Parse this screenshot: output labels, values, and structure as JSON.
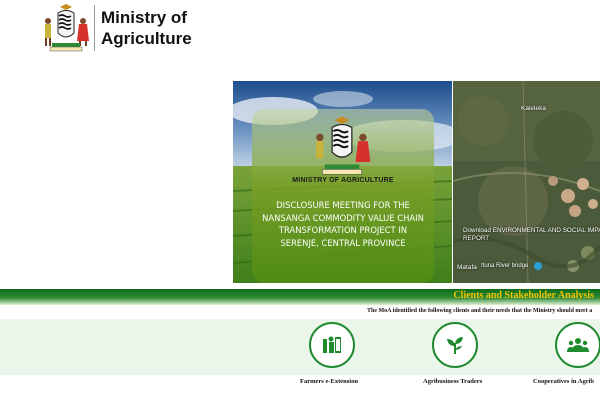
{
  "header": {
    "brand_line1": "Ministry of",
    "brand_line2": "Agriculture",
    "logo_icon": "zambia-coat-of-arms-icon"
  },
  "slideshow": {
    "card_ministry": "MINISTRY OF AGRICULTURE",
    "card_title": "DISCLOSURE MEETING FOR THE NANSANGA COMMODITY VALUE CHAIN TRANSFORMATION PROJECT IN SERENJE, CENTRAL PROVINCE"
  },
  "map": {
    "place_label": "Kaleleka",
    "download_text": "Download ENVIRONMENTAL AND SOCIAL IMPA FINAL REPORT",
    "bottom_label": "Matafa",
    "bridge_label": "Ituna River bridge"
  },
  "clients_section": {
    "title": "Clients and Stakeholder Analysis",
    "intro": "The MoA identified the following clients and their needs that the Ministry should meet a",
    "items": [
      {
        "label": "Farmers e-Extension",
        "icon": "farmers-icon"
      },
      {
        "label": "Agribusiness Traders",
        "icon": "plant-icon"
      },
      {
        "label": "Cooperatives in Agrib",
        "icon": "group-icon"
      }
    ]
  },
  "colors": {
    "accent_green": "#1f8a2e",
    "band_dark": "#0c6b1a",
    "title_yellow": "#f2c200",
    "panel_bg": "#e9f6e9"
  }
}
